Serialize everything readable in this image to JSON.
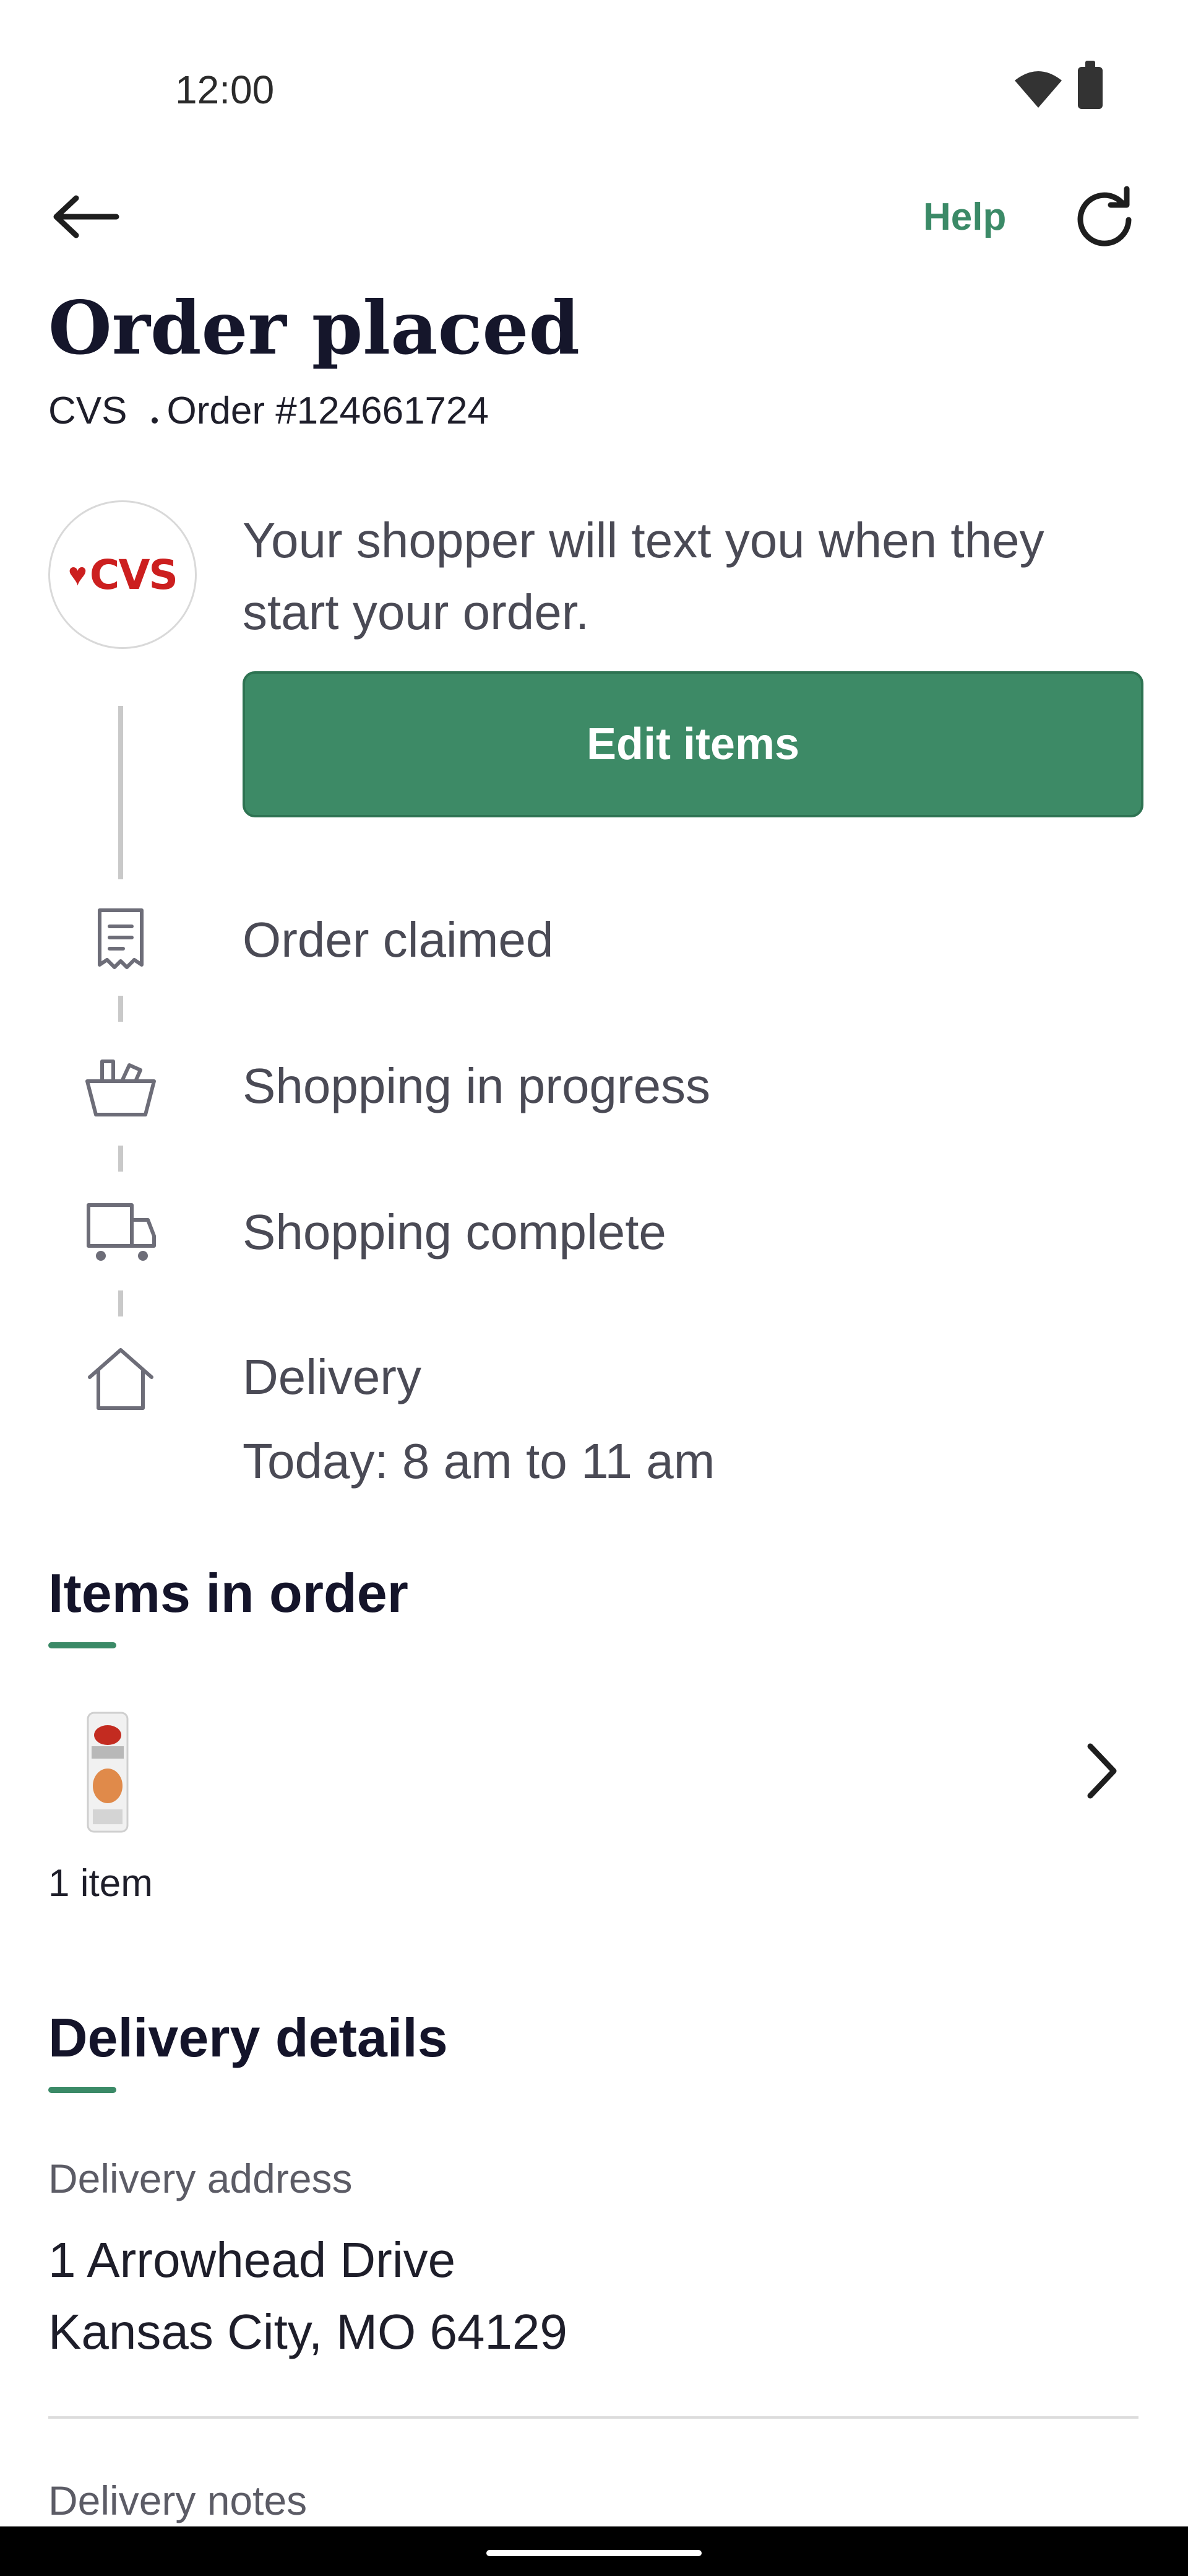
{
  "status_bar": {
    "time": "12:00"
  },
  "header": {
    "help_label": "Help"
  },
  "order": {
    "title": "Order placed",
    "store": "CVS",
    "order_number": "Order #124661724",
    "store_logo_text": "CVS",
    "message": "Your shopper will text you when they start your order.",
    "edit_button": "Edit items"
  },
  "steps": [
    {
      "label": "Order claimed",
      "icon": "receipt-icon"
    },
    {
      "label": "Shopping in progress",
      "icon": "basket-icon"
    },
    {
      "label": "Shopping complete",
      "icon": "cart-icon"
    },
    {
      "label": "Delivery",
      "icon": "home-icon",
      "detail": "Today: 8 am to 11 am"
    }
  ],
  "items_section": {
    "title": "Items in order",
    "count": "1 item"
  },
  "delivery_section": {
    "title": "Delivery details",
    "address_label": "Delivery address",
    "address_line1": "1 Arrowhead Drive",
    "address_line2": "Kansas City, MO 64129",
    "notes_label": "Delivery notes"
  },
  "colors": {
    "accent": "#3b8a67",
    "button": "#3d8a66",
    "title": "#15162b"
  }
}
